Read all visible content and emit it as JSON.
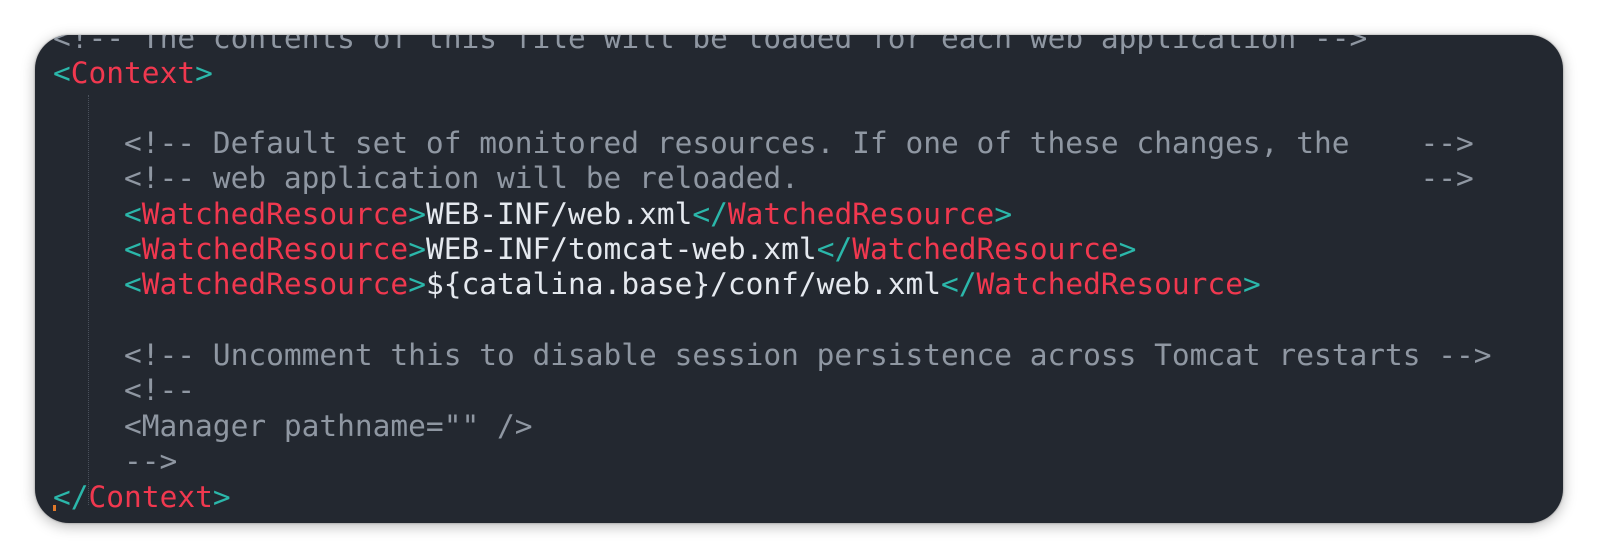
{
  "editor": {
    "lines": {
      "top_comment": "<!-- The contents of this file will be loaded for each web application -->",
      "context_open_lt": "<",
      "context_open_tag": "Context",
      "context_open_gt": ">",
      "comment1": "<!-- Default set of monitored resources. If one of these changes, the    -->",
      "comment2": "<!-- web application will be reloaded.                                   -->",
      "wr1_value": "WEB-INF/web.xml",
      "wr2_value": "WEB-INF/tomcat-web.xml",
      "wr3_value": "${catalina.base}/conf/web.xml",
      "wr_tag": "WatchedResource",
      "open_lt": "<",
      "close_lt": "</",
      "gt": ">",
      "comment3": "<!-- Uncomment this to disable session persistence across Tomcat restarts -->",
      "comment4": "<!--",
      "manager": "<Manager pathname=\"\" />",
      "comment_end": "-->",
      "context_close_lt": "</",
      "context_close_tag": "Context",
      "context_close_gt": ">"
    },
    "colors": {
      "background": "#232830",
      "comment": "#8f97a2",
      "punctuation": "#2bb7aa",
      "tag": "#f0384f",
      "text": "#e5e9ef"
    }
  }
}
